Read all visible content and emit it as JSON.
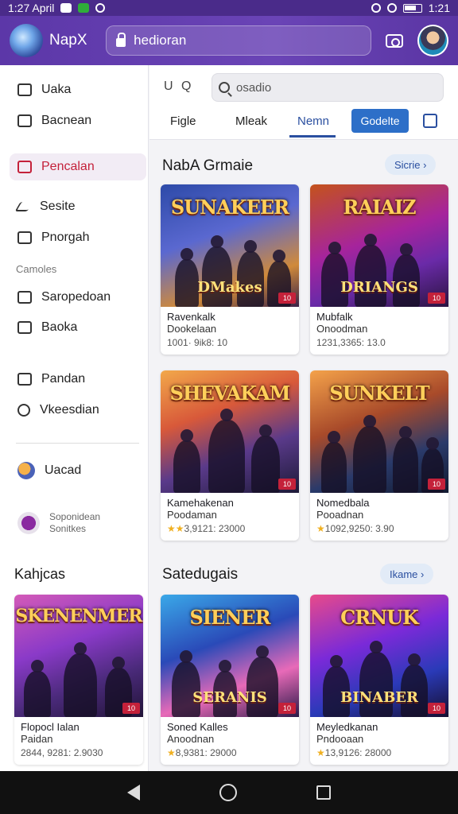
{
  "status_bar": {
    "time": "1:27 April",
    "right_time": "1:21"
  },
  "app_bar": {
    "app_name": "NapX",
    "url": "hedioran"
  },
  "sidebar": {
    "items": [
      {
        "label": "Uaka"
      },
      {
        "label": "Bacnean"
      },
      {
        "label": "Pencalan"
      },
      {
        "label": "Sesite"
      },
      {
        "label": "Pnorgah"
      }
    ],
    "section_label": "Camoles",
    "section_items": [
      {
        "label": "Saropedoan"
      },
      {
        "label": "Baoka"
      },
      {
        "label": "Pandan"
      },
      {
        "label": "Vkeesdian"
      }
    ],
    "extra_item": "Uacad",
    "profile_line1": "Soponidean",
    "profile_line2": "Sonitkes",
    "promo_title": "Kahjcas",
    "promo_card": {
      "art_title": "SKENENMER",
      "title": "Flopocl Ialan",
      "subtitle": "Paidan",
      "meta": "2844, 9281: 2.9030"
    }
  },
  "toolbar": {
    "mini_icons": "U Q",
    "search_placeholder": "osadio",
    "tabs": [
      "Figle",
      "Mleak",
      "Nemn"
    ],
    "pill_button": "Godelte"
  },
  "section1": {
    "title": "NabA Grmaie",
    "see_all": "Sicrie",
    "cards": [
      {
        "art_title": "SUNAKEER",
        "art_sub": "DMakes",
        "title": "Ravenkalk",
        "subtitle": "Dookelaan",
        "meta": "1001· 9ik8: 10",
        "badge": "10"
      },
      {
        "art_title": "RAIAIZ",
        "art_sub": "DRIANGS",
        "title": "Mubfalk",
        "subtitle": "Onoodman",
        "meta": "1231,3365: 13.0",
        "badge": "10"
      },
      {
        "art_title": "SHEVAKAM",
        "art_sub": "",
        "title": "Kamehakenan",
        "subtitle": "Poodaman",
        "meta": "3,9121: 23000",
        "badge": "10"
      },
      {
        "art_title": "SUNKELT",
        "art_sub": "",
        "title": "Nomedbala",
        "subtitle": "Pooadnan",
        "meta": "1092,9250: 3.90",
        "badge": "10"
      }
    ]
  },
  "section2": {
    "title": "Satedugais",
    "see_all": "Ikame",
    "cards": [
      {
        "art_title": "SIENER",
        "art_sub": "SERANIS",
        "title": "Soned Kalles",
        "subtitle": "Anoodnan",
        "meta": "8,9381: 29000",
        "badge": "10"
      },
      {
        "art_title": "CRNUK",
        "art_sub": "BINABER",
        "title": "Meyledkanan",
        "subtitle": "Pndooaan",
        "meta": "13,9126: 28000",
        "badge": "10"
      }
    ]
  }
}
